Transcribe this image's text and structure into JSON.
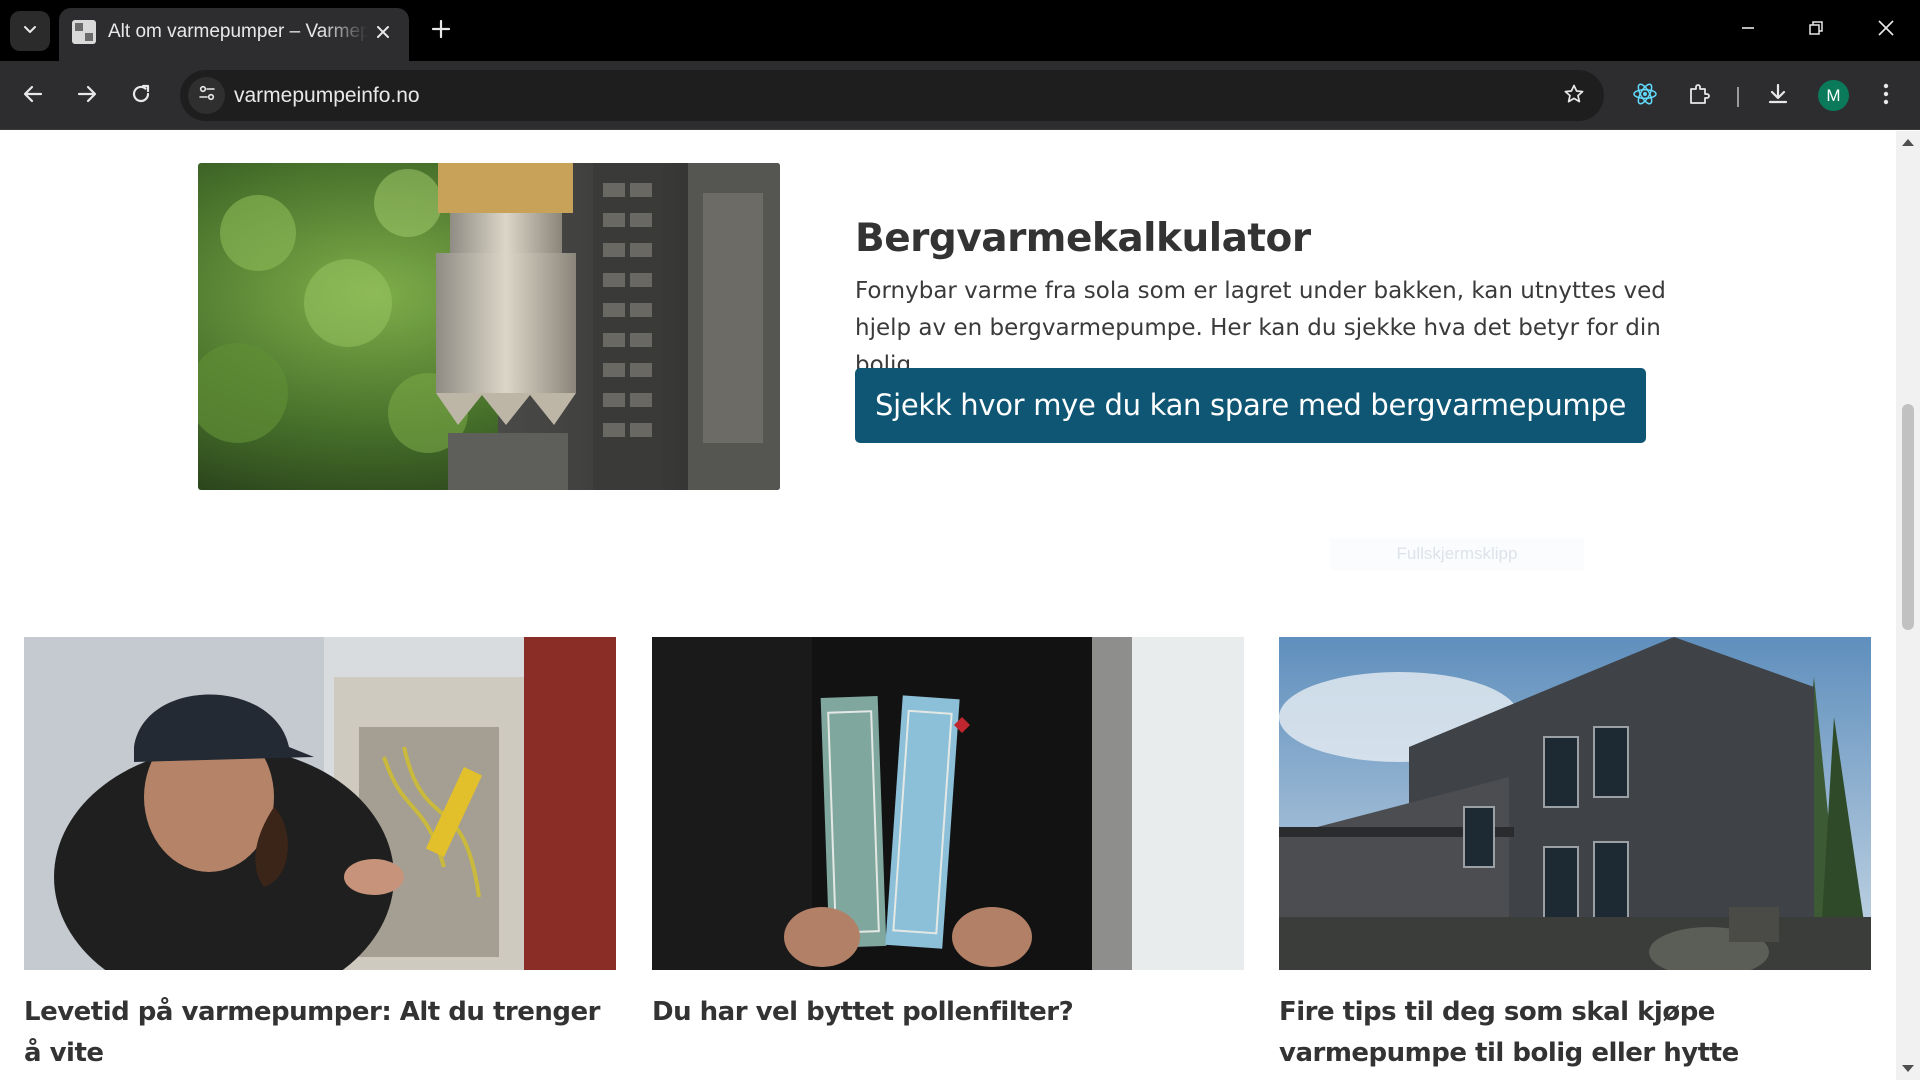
{
  "browser": {
    "tab": {
      "title": "Alt om varmepumper – Varmepumpeinfo"
    },
    "address_bar": {
      "url": "varmepumpeinfo.no"
    },
    "profile_initial": "M"
  },
  "calculator": {
    "title": "Bergvarmekalkulator",
    "description": "Fornybar varme fra sola som er lagret under bakken, kan utnyttes ved hjelp av en bergvarmepumpe. Her kan du sjekke hva det betyr for din bolig.",
    "button_label": "Sjekk hvor mye du kan spare med bergvarmepumpe"
  },
  "overlay_label": "Fullskjermsklipp",
  "articles": [
    {
      "title": "Levetid på varmepumper: Alt du trenger å vite"
    },
    {
      "title": "Du har vel byttet pollenfilter?"
    },
    {
      "title": "Fire tips til deg som skal kjøpe varmepumpe til bolig eller hytte"
    }
  ],
  "colors": {
    "chrome_bg": "#000000",
    "toolbar_bg": "#2d2d30",
    "button_bg": "#0e5674",
    "heading_text": "#333333",
    "avatar_bg": "#0a7a5a"
  }
}
